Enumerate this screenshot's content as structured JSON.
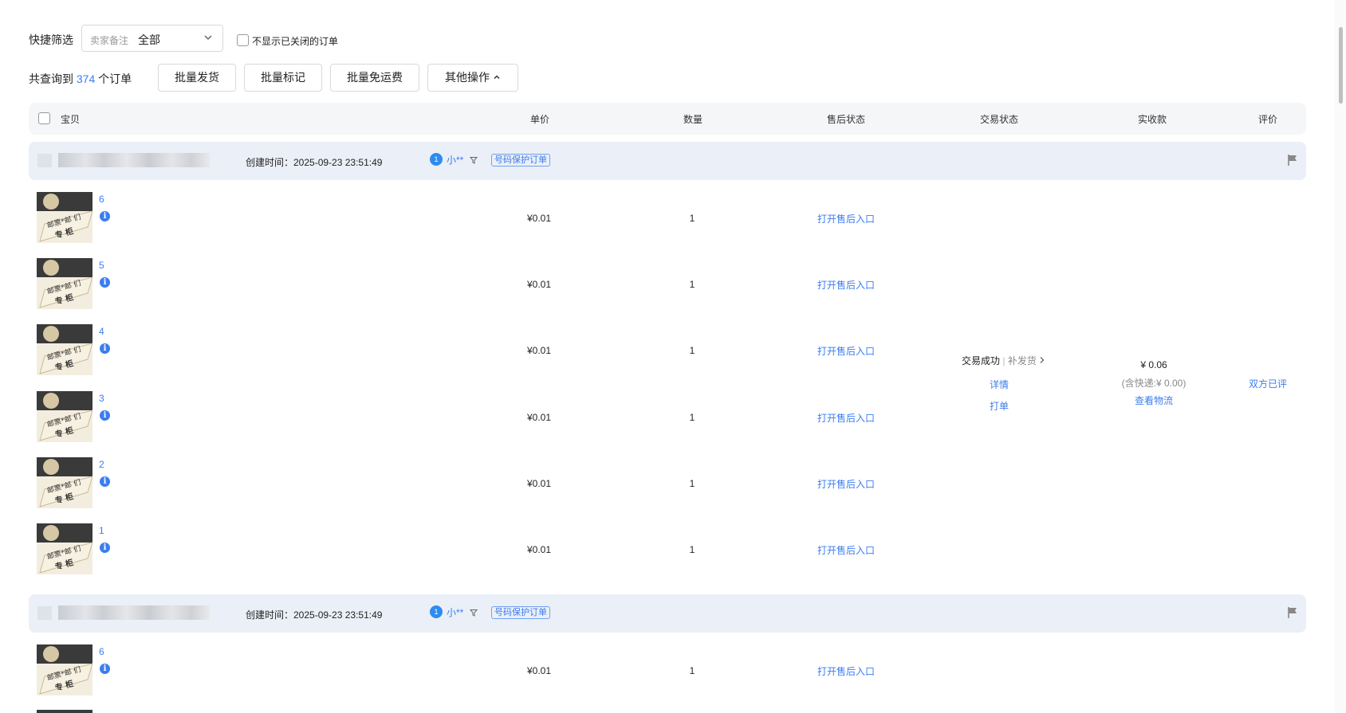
{
  "filter": {
    "label": "快捷筛选",
    "select_placeholder": "卖家备注",
    "select_value": "全部",
    "hide_closed_label": "不显示已关闭的订单"
  },
  "summary": {
    "prefix": "共查询到",
    "count": "374",
    "suffix": "个订单"
  },
  "actions": {
    "batch_ship": "批量发货",
    "batch_mark": "批量标记",
    "batch_free_shipping": "批量免运费",
    "other_ops": "其他操作"
  },
  "columns": {
    "item": "宝贝",
    "unit_price": "单价",
    "quantity": "数量",
    "after_sale_status": "售后状态",
    "trade_status": "交易状态",
    "received": "实收款",
    "review": "评价"
  },
  "orders": [
    {
      "created": "创建时间：2025-09-23 23:51:49",
      "buyer": "小**",
      "buyer_badge": "1",
      "protect_tag": "号码保护订单",
      "items": [
        {
          "idx": "6",
          "price": "¥0.01",
          "qty": "1",
          "after_sale": "打开售后入口"
        },
        {
          "idx": "5",
          "price": "¥0.01",
          "qty": "1",
          "after_sale": "打开售后入口"
        },
        {
          "idx": "4",
          "price": "¥0.01",
          "qty": "1",
          "after_sale": "打开售后入口"
        },
        {
          "idx": "3",
          "price": "¥0.01",
          "qty": "1",
          "after_sale": "打开售后入口"
        },
        {
          "idx": "2",
          "price": "¥0.01",
          "qty": "1",
          "after_sale": "打开售后入口"
        },
        {
          "idx": "1",
          "price": "¥0.01",
          "qty": "1",
          "after_sale": "打开售后入口"
        }
      ],
      "trade_status": "交易成功",
      "trade_sub": "补发货",
      "detail_link": "详情",
      "print_link": "打单",
      "amount": "¥ 0.06",
      "shipping_note": "(含快递:¥ 0.00)",
      "logistics_link": "查看物流",
      "review": "双方已评"
    },
    {
      "created": "创建时间：2025-09-23 23:51:49",
      "buyer": "小**",
      "buyer_badge": "1",
      "protect_tag": "号码保护订单",
      "items": [
        {
          "idx": "6",
          "price": "¥0.01",
          "qty": "1",
          "after_sale": "打开售后入口"
        }
      ]
    }
  ],
  "thumb_text": {
    "line1": "邮票*邮 们",
    "line2": "专 柜"
  },
  "colors": {
    "accent": "#3b7df0",
    "header_bg": "#f5f6f8",
    "order_header_bg": "#ebeff7"
  }
}
